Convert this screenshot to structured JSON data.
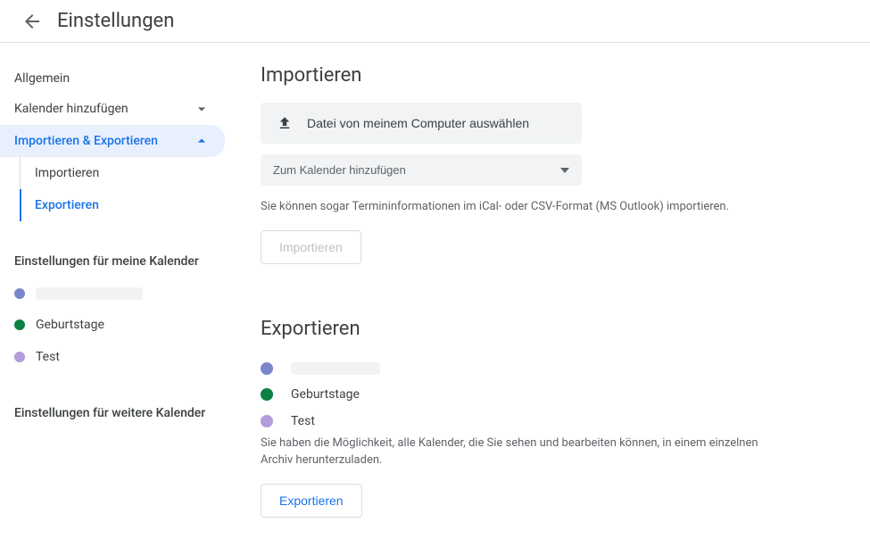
{
  "header": {
    "title": "Einstellungen"
  },
  "sidebar": {
    "general": "Allgemein",
    "add_calendar": "Kalender hinzufügen",
    "import_export": "Importieren & Exportieren",
    "sub_import": "Importieren",
    "sub_export": "Exportieren",
    "section_my_calendars": "Einstellungen für meine Kalender",
    "calendars": [
      {
        "color": "#7986cb",
        "label": ""
      },
      {
        "color": "#0b8043",
        "label": "Geburtstage"
      },
      {
        "color": "#b39ddb",
        "label": "Test"
      }
    ],
    "section_other_calendars": "Einstellungen für weitere Kalender"
  },
  "import": {
    "title": "Importieren",
    "file_button": "Datei von meinem Computer auswählen",
    "select_label": "Zum Kalender hinzufügen",
    "hint": "Sie können sogar Termininformationen im iCal- oder CSV-Format (MS Outlook) importieren.",
    "button": "Importieren"
  },
  "export": {
    "title": "Exportieren",
    "calendars": [
      {
        "color": "#7986cb",
        "label": ""
      },
      {
        "color": "#0b8043",
        "label": "Geburtstage"
      },
      {
        "color": "#b39ddb",
        "label": "Test"
      }
    ],
    "hint": "Sie haben die Möglichkeit, alle Kalender, die Sie sehen und bearbeiten können, in einem einzelnen Archiv herunterzuladen.",
    "button": "Exportieren"
  }
}
